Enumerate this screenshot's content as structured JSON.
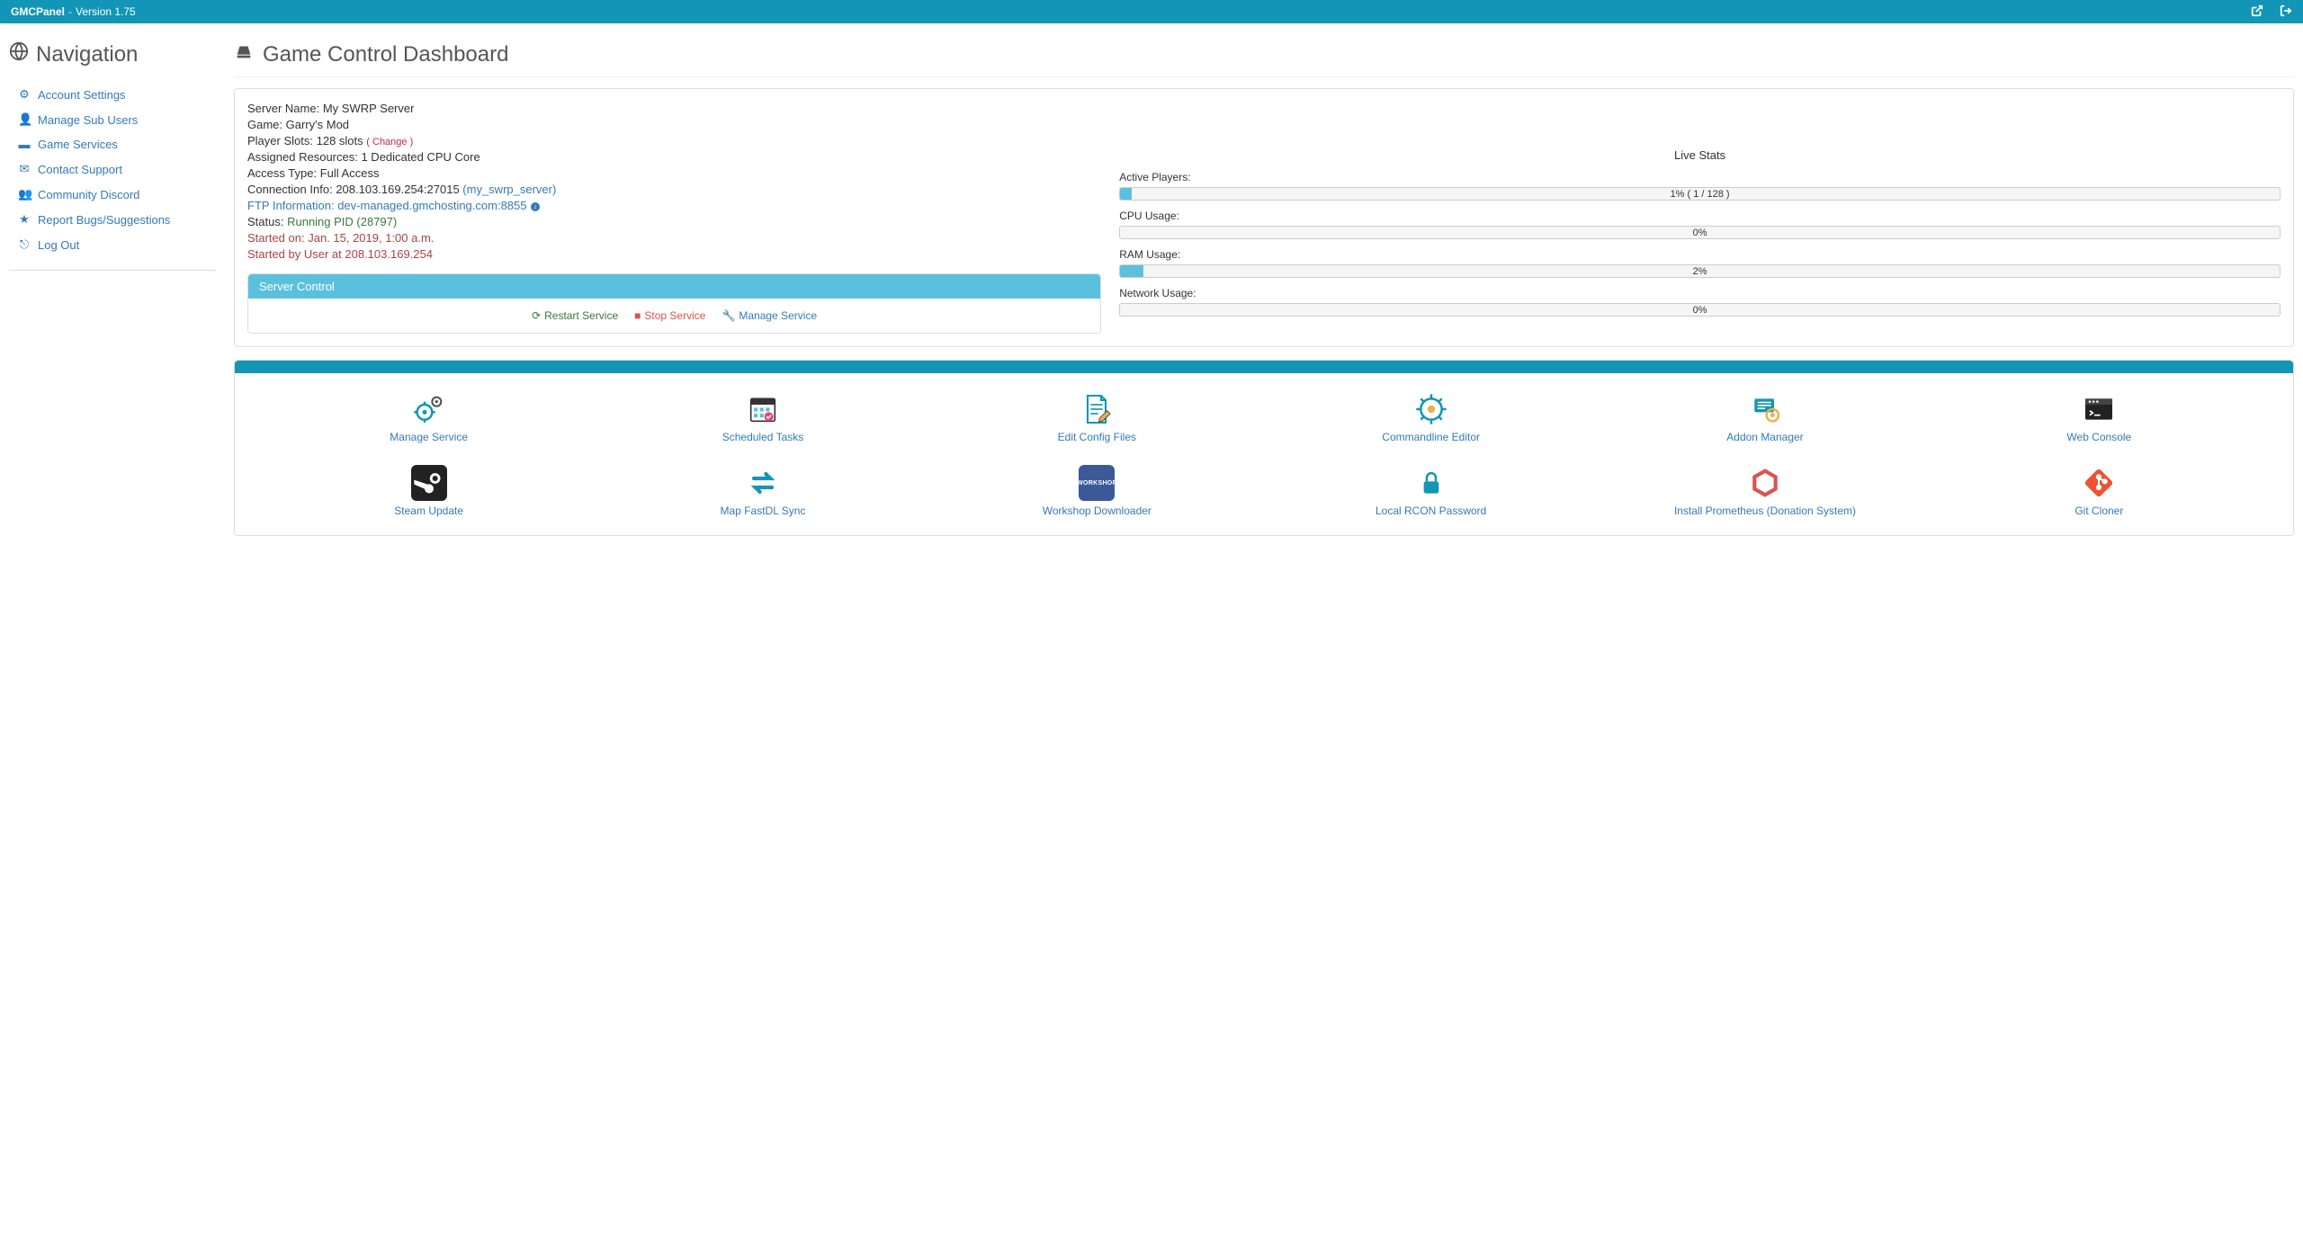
{
  "header": {
    "brand": "GMCPanel",
    "sep": "-",
    "version": "Version 1.75"
  },
  "sidebar": {
    "title": "Navigation",
    "items": [
      {
        "label": "Account Settings",
        "icon": "gear-icon"
      },
      {
        "label": "Manage Sub Users",
        "icon": "user-icon"
      },
      {
        "label": "Game Services",
        "icon": "hdd-icon"
      },
      {
        "label": "Contact Support",
        "icon": "envelope-icon"
      },
      {
        "label": "Community Discord",
        "icon": "users-icon"
      },
      {
        "label": "Report Bugs/Suggestions",
        "icon": "star-icon"
      },
      {
        "label": "Log Out",
        "icon": "signout-icon"
      }
    ]
  },
  "page": {
    "title": "Game Control Dashboard"
  },
  "info": {
    "server_name_label": "Server Name:",
    "server_name": "My SWRP Server",
    "game_label": "Game:",
    "game": "Garry's Mod",
    "slots_label": "Player Slots:",
    "slots": "128 slots",
    "change": "( Change )",
    "resources_label": "Assigned Resources:",
    "resources": "1 Dedicated CPU Core",
    "access_label": "Access Type:",
    "access": "Full Access",
    "conn_label": "Connection Info:",
    "conn": "208.103.169.254:27015",
    "conn_alias": "(my_swrp_server)",
    "ftp_label": "FTP Information:",
    "ftp_host": "dev-managed.gmchosting.com:8855",
    "status_label": "Status:",
    "status_value": "Running PID (28797)",
    "started_on": "Started on: Jan. 15, 2019, 1:00 a.m.",
    "started_by": "Started by User at 208.103.169.254"
  },
  "control": {
    "header": "Server Control",
    "restart": "Restart Service",
    "stop": "Stop Service",
    "manage": "Manage Service"
  },
  "stats": {
    "title": "Live Stats",
    "players_label": "Active Players:",
    "players_text": "1% ( 1 / 128 )",
    "players_pct": 1,
    "cpu_label": "CPU Usage:",
    "cpu_text": "0%",
    "cpu_pct": 0,
    "ram_label": "RAM Usage:",
    "ram_text": "2%",
    "ram_pct": 2,
    "net_label": "Network Usage:",
    "net_text": "0%",
    "net_pct": 0
  },
  "features": [
    {
      "label": "Manage Service",
      "icon": "gears"
    },
    {
      "label": "Scheduled Tasks",
      "icon": "calendar"
    },
    {
      "label": "Edit Config Files",
      "icon": "edit-file"
    },
    {
      "label": "Commandline Editor",
      "icon": "cmd-gear"
    },
    {
      "label": "Addon Manager",
      "icon": "addon"
    },
    {
      "label": "Web Console",
      "icon": "console"
    },
    {
      "label": "Steam Update",
      "icon": "steam"
    },
    {
      "label": "Map FastDL Sync",
      "icon": "sync"
    },
    {
      "label": "Workshop Downloader",
      "icon": "workshop"
    },
    {
      "label": "Local RCON Password",
      "icon": "lock"
    },
    {
      "label": "Install Prometheus (Donation System)",
      "icon": "prometheus"
    },
    {
      "label": "Git Cloner",
      "icon": "git"
    }
  ]
}
